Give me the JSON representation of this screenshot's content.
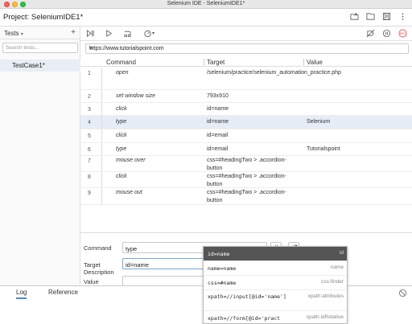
{
  "window": {
    "title": "Selenium IDE - SeleniumIDE1*"
  },
  "project": {
    "label": "Project:",
    "name": "SeleniumIDE1*"
  },
  "sidebar": {
    "title": "Tests",
    "search_placeholder": "Search tests...",
    "tests": [
      {
        "name": "TestCase1*"
      }
    ]
  },
  "url": {
    "value": "https://www.tutorialspoint.com"
  },
  "table": {
    "headers": {
      "command": "Command",
      "target": "Target",
      "value": "Value"
    },
    "rows": [
      {
        "num": "1",
        "command": "open",
        "target": "/selenium/practice/selenium_automation_practice.php",
        "value": ""
      },
      {
        "num": "2",
        "command": "set window size",
        "target": "793x910",
        "value": ""
      },
      {
        "num": "3",
        "command": "click",
        "target": "id=name",
        "value": ""
      },
      {
        "num": "4",
        "command": "type",
        "target": "id=name",
        "value": "Selenium"
      },
      {
        "num": "5",
        "command": "click",
        "target": "id=email",
        "value": ""
      },
      {
        "num": "6",
        "command": "type",
        "target": "id=email",
        "value": "Tutorialspoint"
      },
      {
        "num": "7",
        "command": "mouse over",
        "target": "css=#headingTwo > .accordion-button",
        "value": ""
      },
      {
        "num": "8",
        "command": "click",
        "target": "css=#headingTwo > .accordion-button",
        "value": ""
      },
      {
        "num": "9",
        "command": "mouse out",
        "target": "css=#headingTwo > .accordion-button",
        "value": ""
      }
    ]
  },
  "editor": {
    "command_label": "Command",
    "command_value": "type",
    "comment_button": "//",
    "target_label": "Target",
    "target_value": "id=name",
    "value_label": "Value",
    "description_label": "Description"
  },
  "locator_popup": {
    "items": [
      {
        "locator": "id=name",
        "type": "id"
      },
      {
        "locator": "name=name",
        "type": "name"
      },
      {
        "locator": "css=#name",
        "type": "css:finder"
      },
      {
        "locator": "xpath=//input[@id='name']",
        "type": "xpath:attributes"
      },
      {
        "locator": "xpath=//form[@id='pract",
        "type": "xpath:idRelative"
      }
    ]
  },
  "bottom": {
    "tabs": [
      "Log",
      "Reference"
    ]
  },
  "colors": {
    "selected_row": "#e6edf6",
    "popup_highlight": "#555555",
    "record": "#e0413a",
    "active_tab": "#4a8ad4"
  }
}
